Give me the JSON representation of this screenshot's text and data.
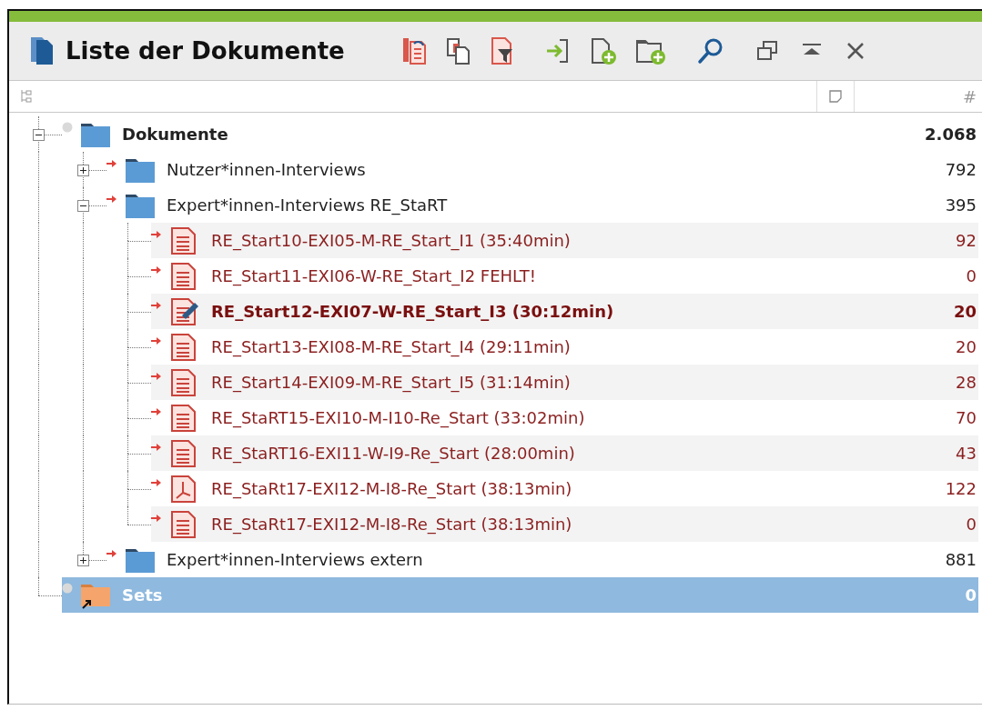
{
  "title": "Liste der Dokumente",
  "columns": {
    "count_header": "#"
  },
  "tree": [
    {
      "kind": "folder",
      "label": "Dokumente",
      "count": "2.068",
      "expanded": true,
      "selected": false,
      "children": [
        {
          "kind": "folder",
          "label": "Nutzer*innen-Interviews",
          "count": "792",
          "expanded": false,
          "selected": false
        },
        {
          "kind": "folder",
          "label": "Expert*innen-Interviews RE_StaRT",
          "count": "395",
          "expanded": true,
          "selected": false,
          "children": [
            {
              "kind": "text",
              "label": "RE_Start10-EXI05-M-RE_Start_I1 (35:40min)",
              "count": "92",
              "open": false,
              "selected": false
            },
            {
              "kind": "text",
              "label": "RE_Start11-EXI06-W-RE_Start_I2 FEHLT!",
              "count": "0",
              "open": false,
              "selected": false
            },
            {
              "kind": "text",
              "label": "RE_Start12-EXI07-W-RE_Start_I3 (30:12min)",
              "count": "20",
              "open": true,
              "selected": false
            },
            {
              "kind": "text",
              "label": "RE_Start13-EXI08-M-RE_Start_I4 (29:11min)",
              "count": "20",
              "open": false,
              "selected": false
            },
            {
              "kind": "text",
              "label": "RE_Start14-EXI09-M-RE_Start_I5 (31:14min)",
              "count": "28",
              "open": false,
              "selected": false
            },
            {
              "kind": "text",
              "label": "RE_StaRT15-EXI10-M-I10-Re_Start (33:02min)",
              "count": "70",
              "open": false,
              "selected": false
            },
            {
              "kind": "text",
              "label": "RE_StaRT16-EXI11-W-I9-Re_Start (28:00min)",
              "count": "43",
              "open": false,
              "selected": false
            },
            {
              "kind": "pdf",
              "label": "RE_StaRt17-EXI12-M-I8-Re_Start (38:13min)",
              "count": "122",
              "open": false,
              "selected": false
            },
            {
              "kind": "text",
              "label": "RE_StaRt17-EXI12-M-I8-Re_Start (38:13min)",
              "count": "0",
              "open": false,
              "selected": false
            }
          ]
        },
        {
          "kind": "folder",
          "label": "Expert*innen-Interviews extern",
          "count": "881",
          "expanded": false,
          "selected": false
        }
      ]
    },
    {
      "kind": "set",
      "label": "Sets",
      "count": "0",
      "selected": true
    }
  ]
}
